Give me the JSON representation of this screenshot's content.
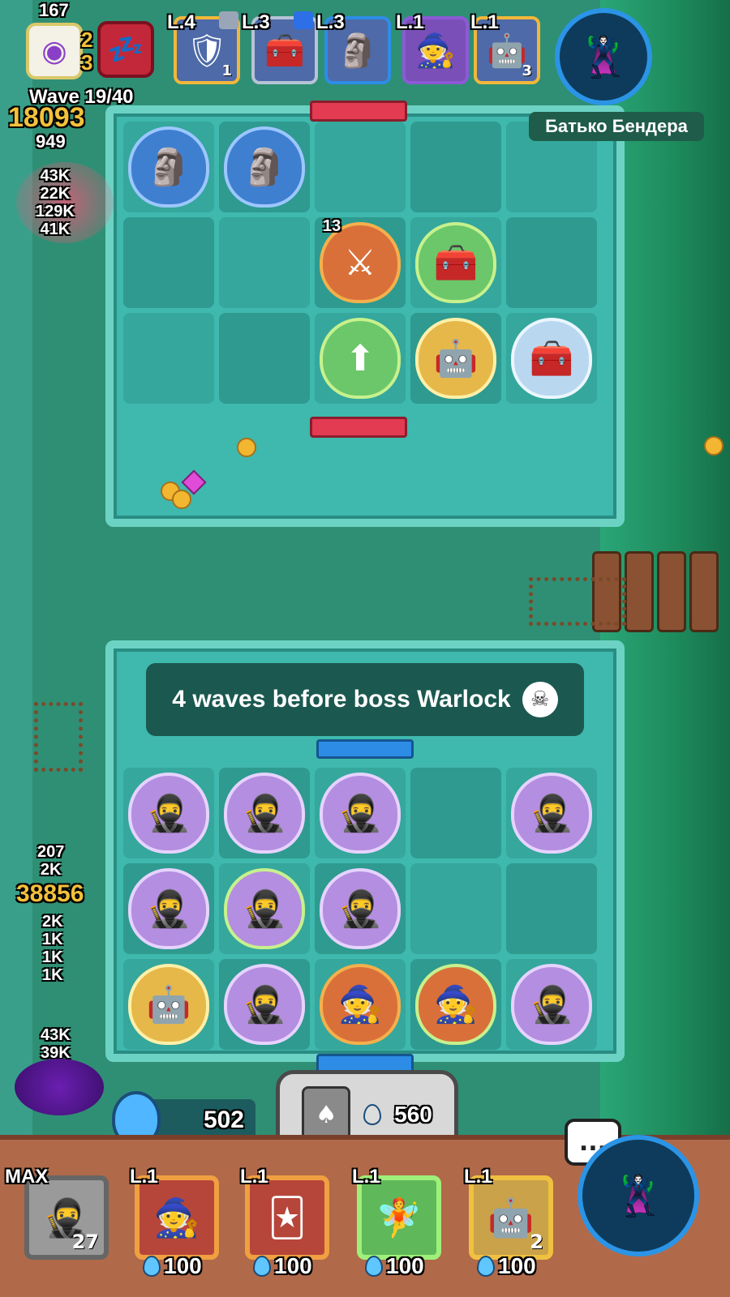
{
  "hud": {
    "wave_label": "Wave 19/40",
    "score": "18093",
    "kills": "949",
    "top_partial": "167",
    "left_side_digits": [
      "2",
      "3"
    ],
    "left_damage_numbers": [
      "43K",
      "22K",
      "129K",
      "41K"
    ]
  },
  "opponent": {
    "name": "Батько Бендера",
    "deck": [
      {
        "level": "L.4",
        "icon": "knight-icon",
        "count": "1"
      },
      {
        "level": "L.3",
        "icon": "chest-icon",
        "count": ""
      },
      {
        "level": "L.3",
        "icon": "stone-golem-icon",
        "count": ""
      },
      {
        "level": "L.1",
        "icon": "wizard-icon",
        "count": ""
      },
      {
        "level": "L.1",
        "icon": "frost-robot-icon",
        "count": "3"
      }
    ]
  },
  "board_top": {
    "merge_badge": "13"
  },
  "banner": {
    "text": "4 waves before boss Warlock"
  },
  "player": {
    "score": "38856",
    "damage_numbers": [
      "207",
      "2K",
      "2K",
      "1K",
      "1K",
      "1K",
      "43K",
      "39K"
    ],
    "mana": "502",
    "summon_cost": "560",
    "chat_glyph": "...",
    "deck": [
      {
        "level": "MAX",
        "icon": "hooded-hero-icon",
        "count": "27",
        "cost": "100"
      },
      {
        "level": "L.1",
        "icon": "fire-mage-icon",
        "count": "",
        "cost": "100"
      },
      {
        "level": "L.1",
        "icon": "jester-icon",
        "count": "",
        "cost": "100"
      },
      {
        "level": "L.1",
        "icon": "dryad-icon",
        "count": "",
        "cost": "100"
      },
      {
        "level": "L.1",
        "icon": "frost-robot-icon",
        "count": "2",
        "cost": "100"
      }
    ]
  },
  "colors": {
    "board": "#3fb8ad",
    "board_border": "#6cd3c4",
    "score_gold": "#f3c13a",
    "bottom_bar": "#b06a4a"
  }
}
